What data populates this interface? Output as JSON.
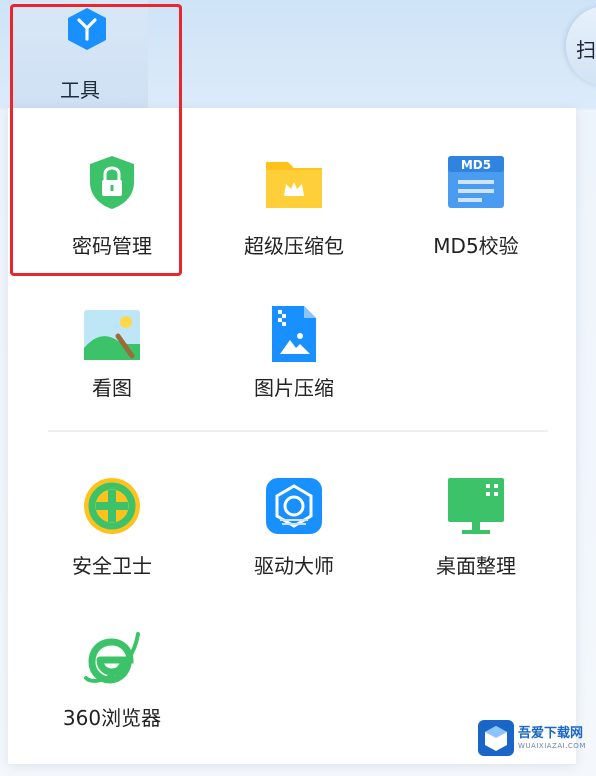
{
  "header": {
    "active_tab_label": "工具",
    "right_tab_partial_label": "扫"
  },
  "tools": {
    "row1": [
      {
        "label": "密码管理",
        "icon": "shield-lock-icon"
      },
      {
        "label": "超级压缩包",
        "icon": "folder-crown-icon"
      },
      {
        "label": "MD5校验",
        "icon": "md5-file-icon",
        "icon_text": "MD5"
      }
    ],
    "row2": [
      {
        "label": "看图",
        "icon": "landscape-image-icon"
      },
      {
        "label": "图片压缩",
        "icon": "zip-image-file-icon"
      }
    ],
    "row3": [
      {
        "label": "安全卫士",
        "icon": "shield-plus-icon"
      },
      {
        "label": "驱动大师",
        "icon": "driver-gear-icon"
      },
      {
        "label": "桌面整理",
        "icon": "monitor-icon"
      }
    ],
    "row4": [
      {
        "label": "360浏览器",
        "icon": "browser-e-icon"
      }
    ]
  },
  "watermark": {
    "text": "吾爱下载网",
    "subtext": "WUAIXIAZAI.COM"
  },
  "colors": {
    "highlight_border": "#e8262b",
    "accent_blue": "#1890ff",
    "icon_green": "#3cc36a",
    "icon_yellow": "#ffc21c"
  }
}
